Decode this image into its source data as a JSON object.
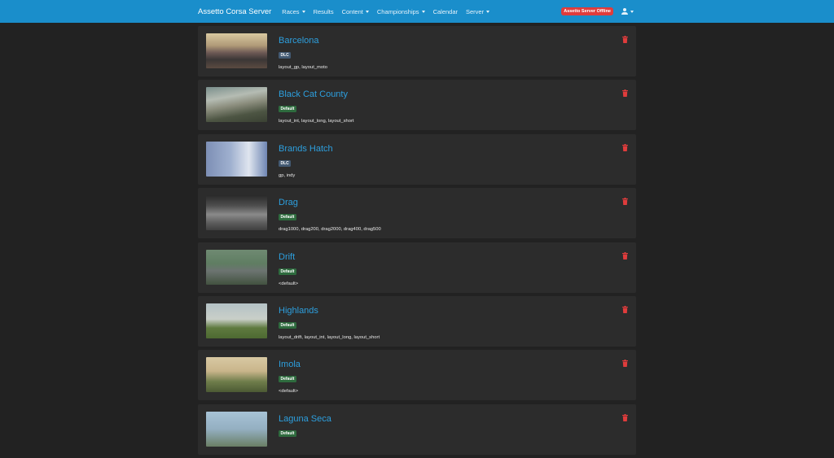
{
  "navbar": {
    "brand": "Assetto Corsa Server",
    "items": [
      {
        "label": "Races",
        "dropdown": true
      },
      {
        "label": "Results",
        "dropdown": false
      },
      {
        "label": "Content",
        "dropdown": true
      },
      {
        "label": "Championships",
        "dropdown": true
      },
      {
        "label": "Calendar",
        "dropdown": false
      },
      {
        "label": "Server",
        "dropdown": true
      }
    ],
    "status_badge": "Assetto Server Offline",
    "user_icon": "user-icon"
  },
  "colors": {
    "navbar": "#1a8ecb",
    "page_background": "#222222",
    "card_background": "#2c2c2c",
    "track_name": "#2d9fde",
    "offline_badge": "#e03c3c",
    "dlc_badge": "#435a73",
    "default_badge": "#2e6b3e",
    "delete_icon": "#e03c3c"
  },
  "tracks": [
    {
      "name": "Barcelona",
      "badge": "DLC",
      "layouts": "layout_gp, layout_moto"
    },
    {
      "name": "Black Cat County",
      "badge": "Default",
      "layouts": "layout_int, layout_long, layout_short"
    },
    {
      "name": "Brands Hatch",
      "badge": "DLC",
      "layouts": "gp, indy"
    },
    {
      "name": "Drag",
      "badge": "Default",
      "layouts": "drag1000, drag200, drag2000, drag400, drag500"
    },
    {
      "name": "Drift",
      "badge": "Default",
      "layouts": "<default>"
    },
    {
      "name": "Highlands",
      "badge": "Default",
      "layouts": "layout_drift, layout_int, layout_long, layout_short"
    },
    {
      "name": "Imola",
      "badge": "Default",
      "layouts": "<default>"
    },
    {
      "name": "Laguna Seca",
      "badge": "Default",
      "layouts": ""
    }
  ]
}
